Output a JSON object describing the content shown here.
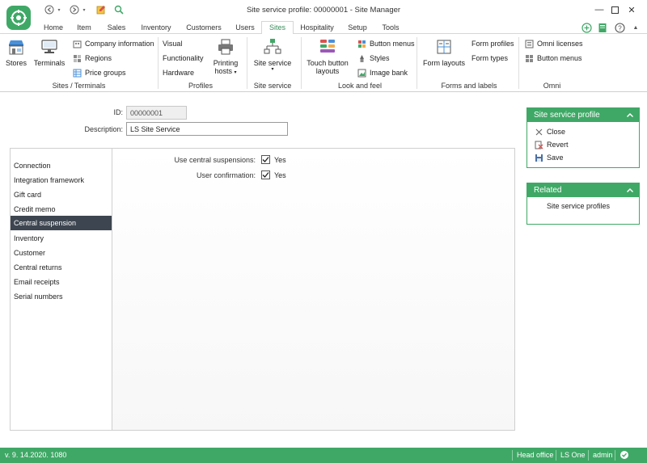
{
  "window": {
    "title": "Site service profile: 00000001 - Site Manager"
  },
  "tabs": [
    {
      "label": "Home"
    },
    {
      "label": "Item"
    },
    {
      "label": "Sales"
    },
    {
      "label": "Inventory"
    },
    {
      "label": "Customers"
    },
    {
      "label": "Users"
    },
    {
      "label": "Sites"
    },
    {
      "label": "Hospitality"
    },
    {
      "label": "Setup"
    },
    {
      "label": "Tools"
    }
  ],
  "active_tab": "Sites",
  "ribbon": {
    "sites_terminals": {
      "label": "Sites / Terminals",
      "stores": "Stores",
      "terminals": "Terminals",
      "company_information": "Company information",
      "regions": "Regions",
      "price_groups": "Price groups"
    },
    "profiles": {
      "label": "Profiles",
      "visual": "Visual",
      "functionality": "Functionality",
      "hardware": "Hardware",
      "printing_hosts_1": "Printing",
      "printing_hosts_2": "hosts"
    },
    "site_service": {
      "label": "Site service",
      "button": "Site service"
    },
    "look_and_feel": {
      "label": "Look and feel",
      "touch_button_layouts_1": "Touch button",
      "touch_button_layouts_2": "layouts",
      "button_menus": "Button menus",
      "styles": "Styles",
      "image_bank": "Image bank"
    },
    "forms_and_labels": {
      "label": "Forms and labels",
      "form_layouts": "Form layouts",
      "form_profiles": "Form profiles",
      "form_types": "Form types"
    },
    "omni": {
      "label": "Omni",
      "omni_licenses": "Omni licenses",
      "button_menus": "Button menus"
    }
  },
  "form": {
    "id_label": "ID:",
    "id_value": "00000001",
    "description_label": "Description:",
    "description_value": "LS Site Service"
  },
  "side_nav": [
    {
      "label": "Connection"
    },
    {
      "label": "Integration framework"
    },
    {
      "label": "Gift card"
    },
    {
      "label": "Credit  memo"
    },
    {
      "label": "Central suspension"
    },
    {
      "label": "Inventory"
    },
    {
      "label": "Customer"
    },
    {
      "label": "Central returns"
    },
    {
      "label": "Email receipts"
    },
    {
      "label": "Serial numbers"
    }
  ],
  "selected_side_item": "Central suspension",
  "settings": {
    "use_central_suspensions": {
      "label": "Use central suspensions:",
      "checked": true,
      "text": "Yes"
    },
    "user_confirmation": {
      "label": "User confirmation:",
      "checked": true,
      "text": "Yes"
    }
  },
  "profile_card": {
    "title": "Site service profile",
    "actions": [
      {
        "label": "Close",
        "icon": "close-icon"
      },
      {
        "label": "Revert",
        "icon": "revert-icon"
      },
      {
        "label": "Save",
        "icon": "save-icon"
      }
    ]
  },
  "related_card": {
    "title": "Related",
    "items": [
      {
        "label": "Site service profiles"
      }
    ]
  },
  "status": {
    "version": "v. 9. 14.2020. 1080",
    "store": "Head office",
    "product": "LS One",
    "user": "admin"
  },
  "colors": {
    "accent": "#3fa866",
    "selected": "#3d4550"
  }
}
